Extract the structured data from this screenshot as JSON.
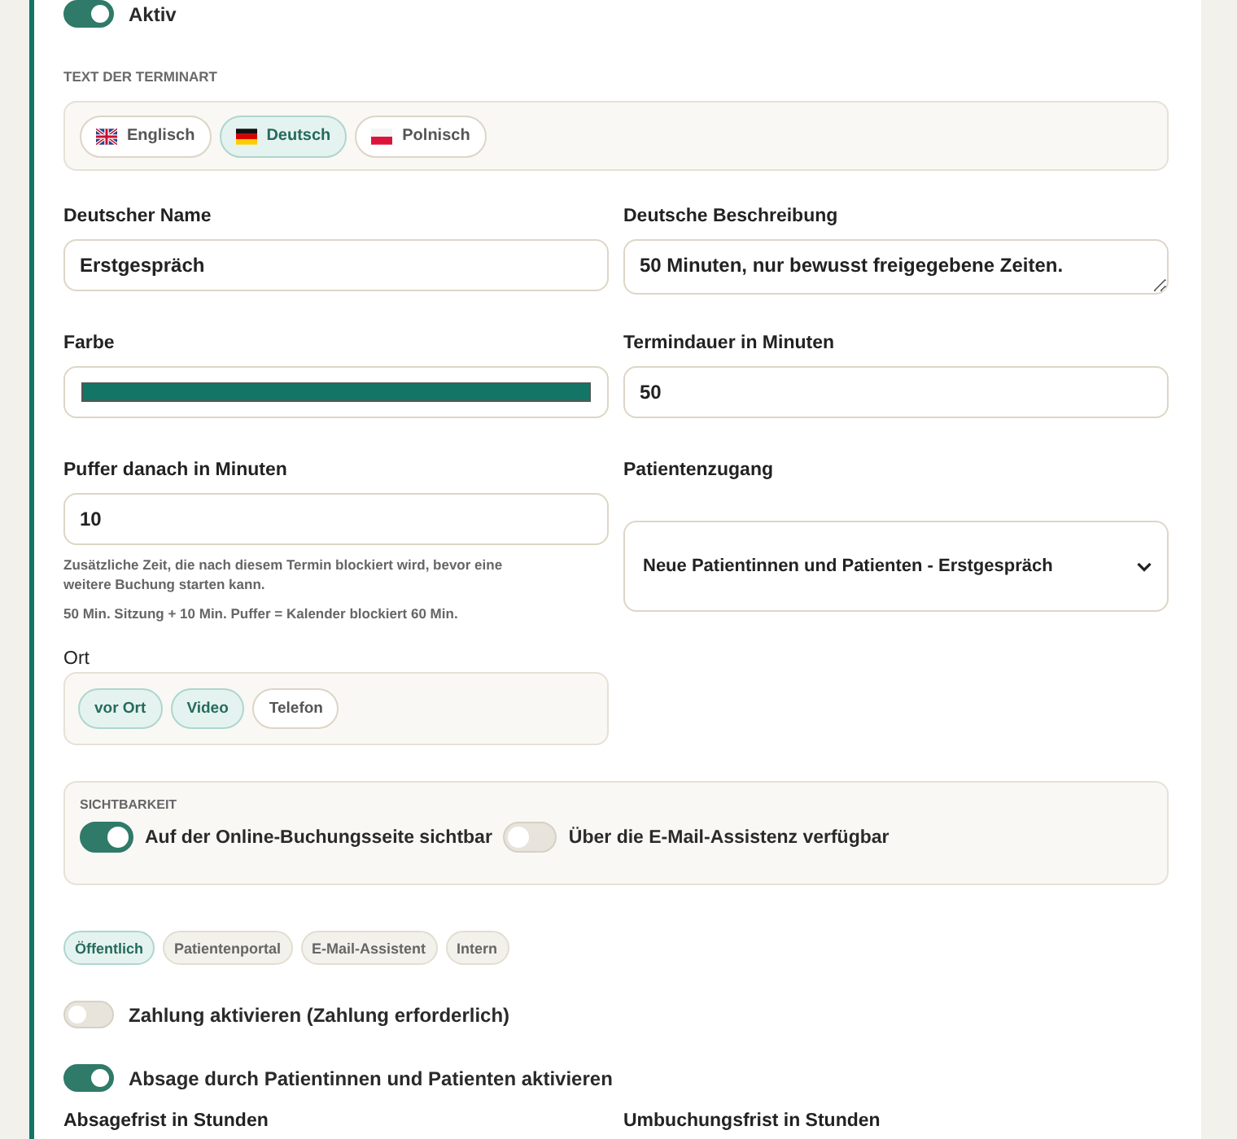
{
  "active_toggle": {
    "label": "Aktiv",
    "on": true
  },
  "language_section": {
    "heading": "TEXT DER TERMINART",
    "tabs": [
      {
        "label": "Englisch",
        "kind": "gb",
        "selected": false
      },
      {
        "label": "Deutsch",
        "kind": "de",
        "selected": true
      },
      {
        "label": "Polnisch",
        "kind": "pl",
        "selected": false
      }
    ]
  },
  "name_field": {
    "label": "Deutscher Name",
    "value": "Erstgespräch"
  },
  "description_field": {
    "label": "Deutsche Beschreibung",
    "value": "50 Minuten, nur bewusst freigegebene Zeiten."
  },
  "color_field": {
    "label": "Farbe",
    "color": "#127566"
  },
  "duration_field": {
    "label": "Termindauer in Minuten",
    "value": "50"
  },
  "buffer_field": {
    "label": "Puffer danach in Minuten",
    "value": "10",
    "help": "Zusätzliche Zeit, die nach diesem Termin blockiert wird, bevor eine weitere Buchung starten kann.",
    "summary": "50 Min. Sitzung + 10 Min. Puffer = Kalender blockiert 60 Min."
  },
  "patient_access": {
    "label": "Patientenzugang",
    "value": "Neue Patientinnen und Patienten - Erstgespräch"
  },
  "location": {
    "label": "Ort",
    "options": [
      {
        "label": "vor Ort",
        "selected": true
      },
      {
        "label": "Video",
        "selected": true
      },
      {
        "label": "Telefon",
        "selected": false
      }
    ]
  },
  "visibility": {
    "heading": "SICHTBARKEIT",
    "toggles": [
      {
        "label": "Auf der Online-Buchungsseite sichtbar",
        "on": true
      },
      {
        "label": "Über die E-Mail-Assistenz verfügbar",
        "on": false
      }
    ]
  },
  "channels": [
    {
      "label": "Öffentlich",
      "selected": true
    },
    {
      "label": "Patientenportal",
      "selected": false
    },
    {
      "label": "E-Mail-Assistent",
      "selected": false
    },
    {
      "label": "Intern",
      "selected": false
    }
  ],
  "options": [
    {
      "label": "Zahlung aktivieren (Zahlung erforderlich)",
      "on": false
    },
    {
      "label": "Absage durch Patientinnen und Patienten aktivieren",
      "on": true
    }
  ],
  "deadline_labels": [
    "Absagefrist in Stunden",
    "Umbuchungsfrist in Stunden"
  ]
}
